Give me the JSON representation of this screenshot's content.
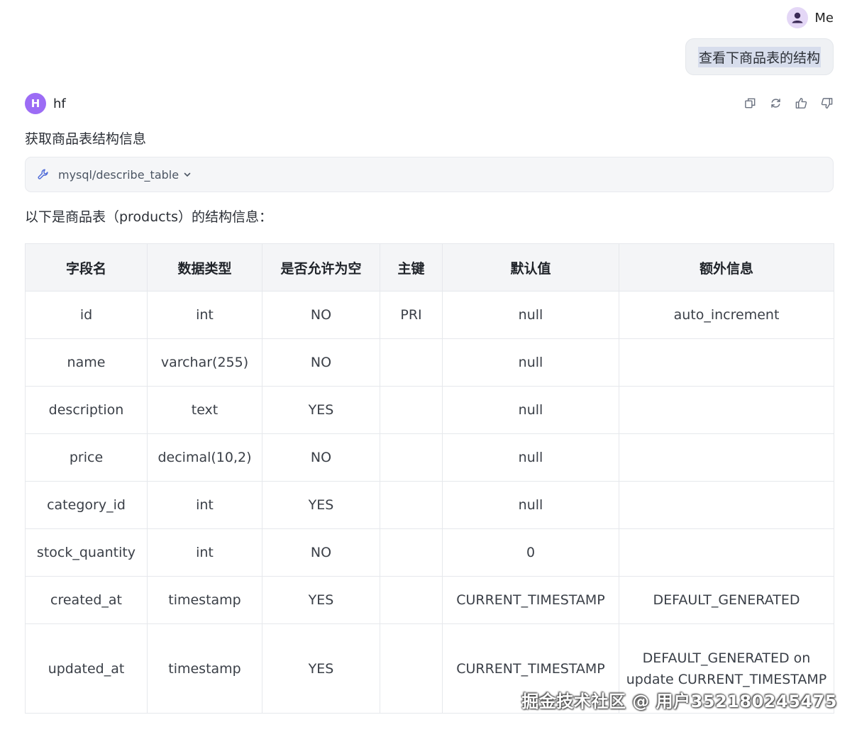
{
  "user": {
    "name": "Me",
    "message": "查看下商品表的结构"
  },
  "assistant": {
    "avatar_letter": "H",
    "name": "hf",
    "intro": "获取商品表结构信息",
    "tool_call": "mysql/describe_table",
    "summary": "以下是商品表（products）的结构信息："
  },
  "actions": [
    "copy-icon",
    "regenerate-icon",
    "thumbs-up-icon",
    "thumbs-down-icon"
  ],
  "table": {
    "headers": [
      "字段名",
      "数据类型",
      "是否允许为空",
      "主键",
      "默认值",
      "额外信息"
    ],
    "rows": [
      [
        "id",
        "int",
        "NO",
        "PRI",
        "null",
        "auto_increment"
      ],
      [
        "name",
        "varchar(255)",
        "NO",
        "",
        "null",
        ""
      ],
      [
        "description",
        "text",
        "YES",
        "",
        "null",
        ""
      ],
      [
        "price",
        "decimal(10,2)",
        "NO",
        "",
        "null",
        ""
      ],
      [
        "category_id",
        "int",
        "YES",
        "",
        "null",
        ""
      ],
      [
        "stock_quantity",
        "int",
        "NO",
        "",
        "0",
        ""
      ],
      [
        "created_at",
        "timestamp",
        "YES",
        "",
        "CURRENT_TIMESTAMP",
        "DEFAULT_GENERATED"
      ],
      [
        "updated_at",
        "timestamp",
        "YES",
        "",
        "CURRENT_TIMESTAMP",
        "DEFAULT_GENERATED on update CURRENT_TIMESTAMP"
      ]
    ]
  },
  "watermark": "掘金技术社区 @ 用户352180245475",
  "colors": {
    "bot_avatar": "#9c6cf5",
    "user_avatar": "#e4d7f6",
    "bubble_bg": "#eff1f4",
    "table_header_bg": "#f4f5f7"
  }
}
